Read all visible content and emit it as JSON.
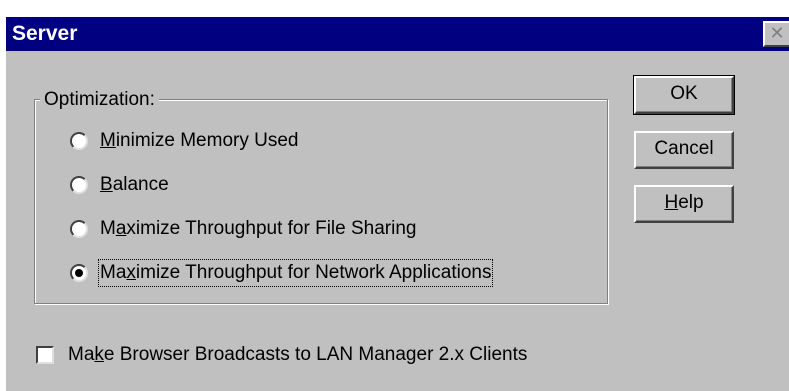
{
  "window": {
    "title": "Server",
    "close_glyph": "✕"
  },
  "optimization": {
    "group_label": "Optimization:",
    "options": [
      {
        "pre": "",
        "key": "M",
        "post": "inimize Memory Used",
        "selected": false
      },
      {
        "pre": "",
        "key": "B",
        "post": "alance",
        "selected": false
      },
      {
        "pre": "M",
        "key": "a",
        "post": "ximize Throughput for File Sharing",
        "selected": false
      },
      {
        "pre": "Ma",
        "key": "x",
        "post": "imize Throughput for Network Applications",
        "selected": true
      }
    ]
  },
  "buttons": {
    "ok": "OK",
    "cancel": "Cancel",
    "help_key": "H",
    "help_rest": "elp"
  },
  "checkbox": {
    "pre": "Ma",
    "key": "k",
    "post": "e Browser Broadcasts to LAN Manager 2.x Clients",
    "checked": false
  }
}
